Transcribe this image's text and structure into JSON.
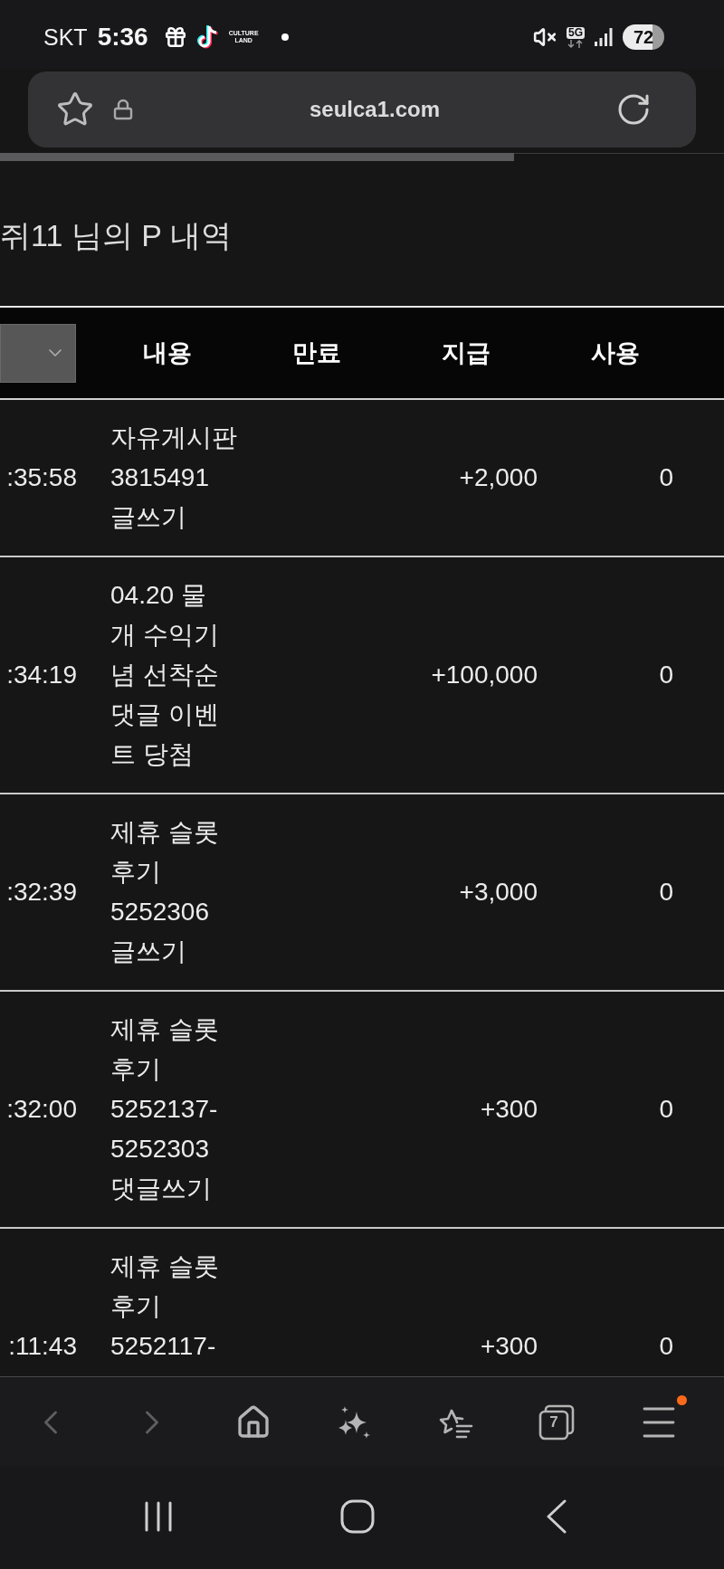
{
  "status_bar": {
    "carrier": "SKT",
    "time": "5:36",
    "notification_logo_text": "CULTURE\nLAND",
    "network_type": "5G",
    "battery": "72"
  },
  "address_bar": {
    "url": "seulca1.com"
  },
  "loading_bar": {
    "level": 0.71
  },
  "page": {
    "title": "쥐11 님의 P 내역"
  },
  "table": {
    "columns": [
      "내용",
      "만료",
      "지급",
      "사용"
    ],
    "rows": [
      {
        "time": ":35:58",
        "content": "자유게시판\n3815491\n글쓰기",
        "paid": "+2,000",
        "used": "0"
      },
      {
        "time": ":34:19",
        "content": "04.20 물\n개 수익기\n념 선착순\n댓글 이벤\n트 당첨",
        "paid": "+100,000",
        "used": "0"
      },
      {
        "time": ":32:39",
        "content": "제휴 슬롯\n후기\n5252306\n글쓰기",
        "paid": "+3,000",
        "used": "0"
      },
      {
        "time": ":32:00",
        "content": "제휴 슬롯\n후기\n5252137-\n5252303\n댓글쓰기",
        "paid": "+300",
        "used": "0"
      },
      {
        "time": ":11:43",
        "content": "제휴 슬롯\n후기\n5252117-",
        "paid": "+300",
        "used": "0"
      }
    ]
  },
  "bottom_toolbar": {
    "back_enabled": false,
    "forward_enabled": false,
    "tab_count": "7",
    "menu_has_notification": true
  }
}
